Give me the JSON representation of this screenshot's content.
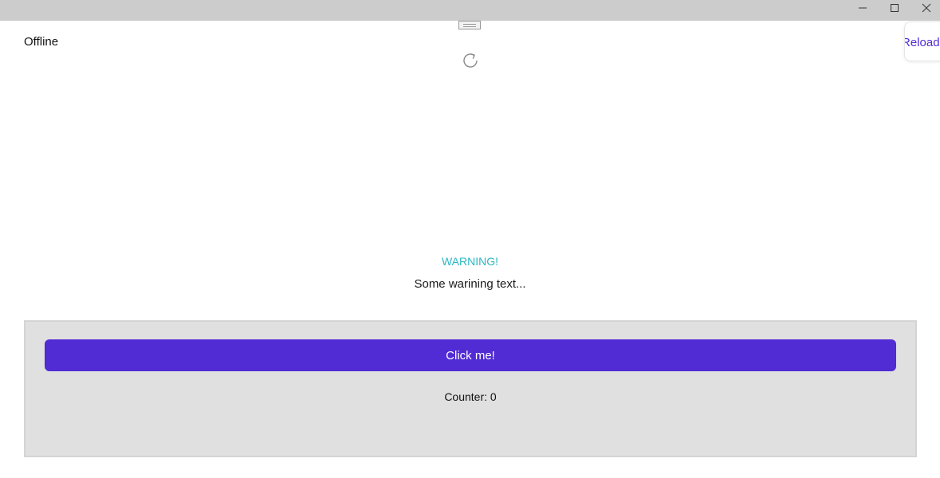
{
  "window": {
    "controls": {
      "minimize_icon": "minimize-icon",
      "maximize_icon": "maximize-icon",
      "close_icon": "close-icon"
    }
  },
  "header": {
    "status": "Offline",
    "reload_label": "Reload"
  },
  "warning": {
    "title": "WARNING!",
    "text": "Some warining text..."
  },
  "panel": {
    "button_label": "Click me!",
    "counter_text": "Counter: 0"
  },
  "colors": {
    "accent": "#512bd4",
    "warning": "#2ab7c4",
    "titlebar": "#cccccc",
    "panel_bg": "#e0e0e0"
  }
}
